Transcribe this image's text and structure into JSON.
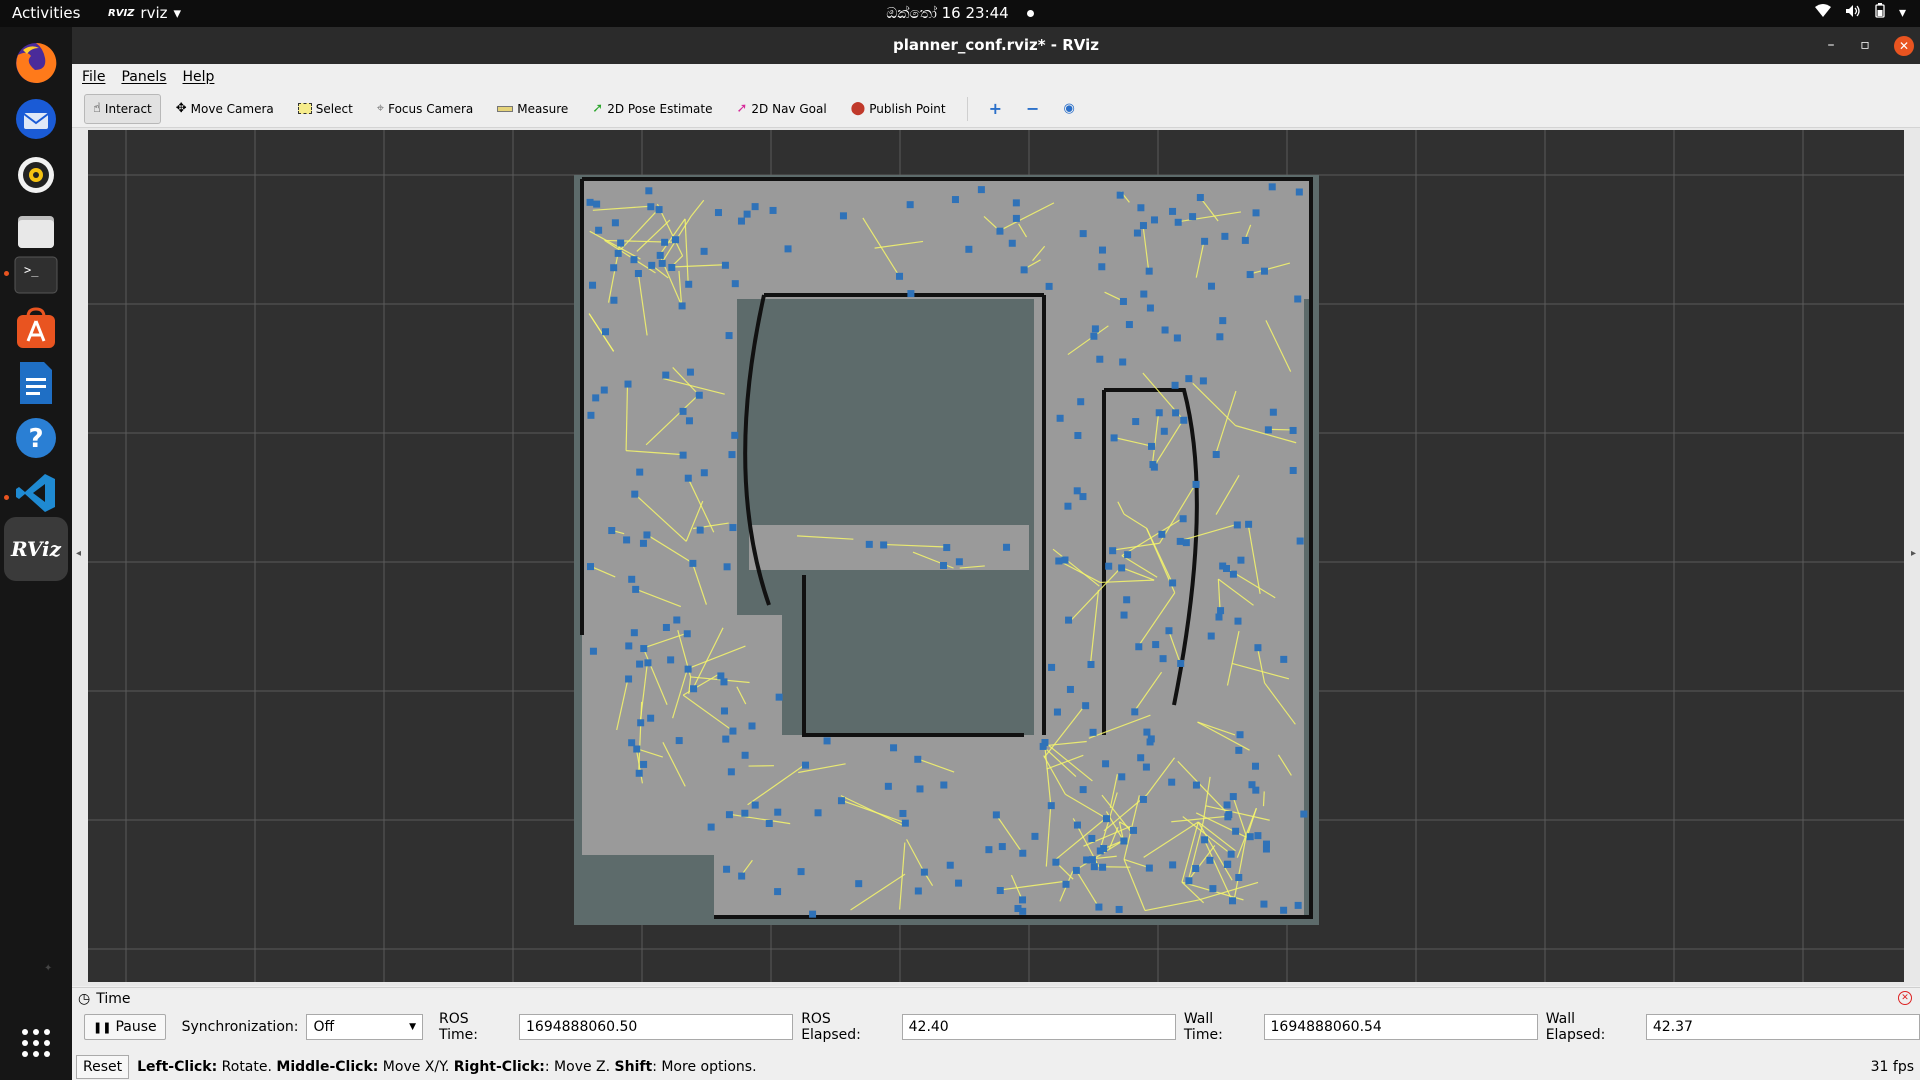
{
  "topbar": {
    "activities": "Activities",
    "app_name": "rviz",
    "app_logo": "RVIZ",
    "clock": "ඔක්‍තෝ 16  23:44"
  },
  "dock": {
    "items": [
      {
        "name": "firefox-icon"
      },
      {
        "name": "thunderbird-icon"
      },
      {
        "name": "rhythmbox-icon"
      },
      {
        "name": "files-icon"
      },
      {
        "name": "terminal-icon"
      },
      {
        "name": "software-center-icon"
      },
      {
        "name": "libreoffice-writer-icon"
      },
      {
        "name": "help-icon"
      },
      {
        "name": "vscode-icon"
      },
      {
        "name": "rviz-icon"
      }
    ],
    "rviz_label": "RViz",
    "terminal_label": ">_"
  },
  "window": {
    "title": "planner_conf.rviz* - RViz"
  },
  "menubar": {
    "file": "File",
    "panels": "Panels",
    "help": "Help"
  },
  "toolbar": {
    "interact": "Interact",
    "move_camera": "Move Camera",
    "select": "Select",
    "focus_camera": "Focus Camera",
    "measure": "Measure",
    "pose_estimate": "2D Pose Estimate",
    "nav_goal": "2D Nav Goal",
    "publish_point": "Publish Point"
  },
  "colors": {
    "map_free": "#9a9a9a",
    "map_unknown": "#5d6b6b",
    "map_wall": "#111111",
    "roadmap_edges": "#f7f76b",
    "roadmap_nodes": "#2f72b8",
    "grid_background": "#303030",
    "accent": "#e95420"
  },
  "time_panel": {
    "title": "Time",
    "pause": "Pause",
    "sync_label": "Synchronization:",
    "sync_value": "Off",
    "ros_time_label": "ROS Time:",
    "ros_time": "1694888060.50",
    "ros_elapsed_label": "ROS Elapsed:",
    "ros_elapsed": "42.40",
    "wall_time_label": "Wall Time:",
    "wall_time": "1694888060.54",
    "wall_elapsed_label": "Wall Elapsed:",
    "wall_elapsed": "42.37"
  },
  "statusbar": {
    "reset": "Reset",
    "hint_left_key": "Left-Click:",
    "hint_left": " Rotate. ",
    "hint_middle_key": "Middle-Click:",
    "hint_middle": " Move X/Y. ",
    "hint_right_key": "Right-Click:",
    "hint_right": ": Move Z. ",
    "hint_shift_key": "Shift",
    "hint_shift": ": More options.",
    "fps": "31 fps"
  }
}
